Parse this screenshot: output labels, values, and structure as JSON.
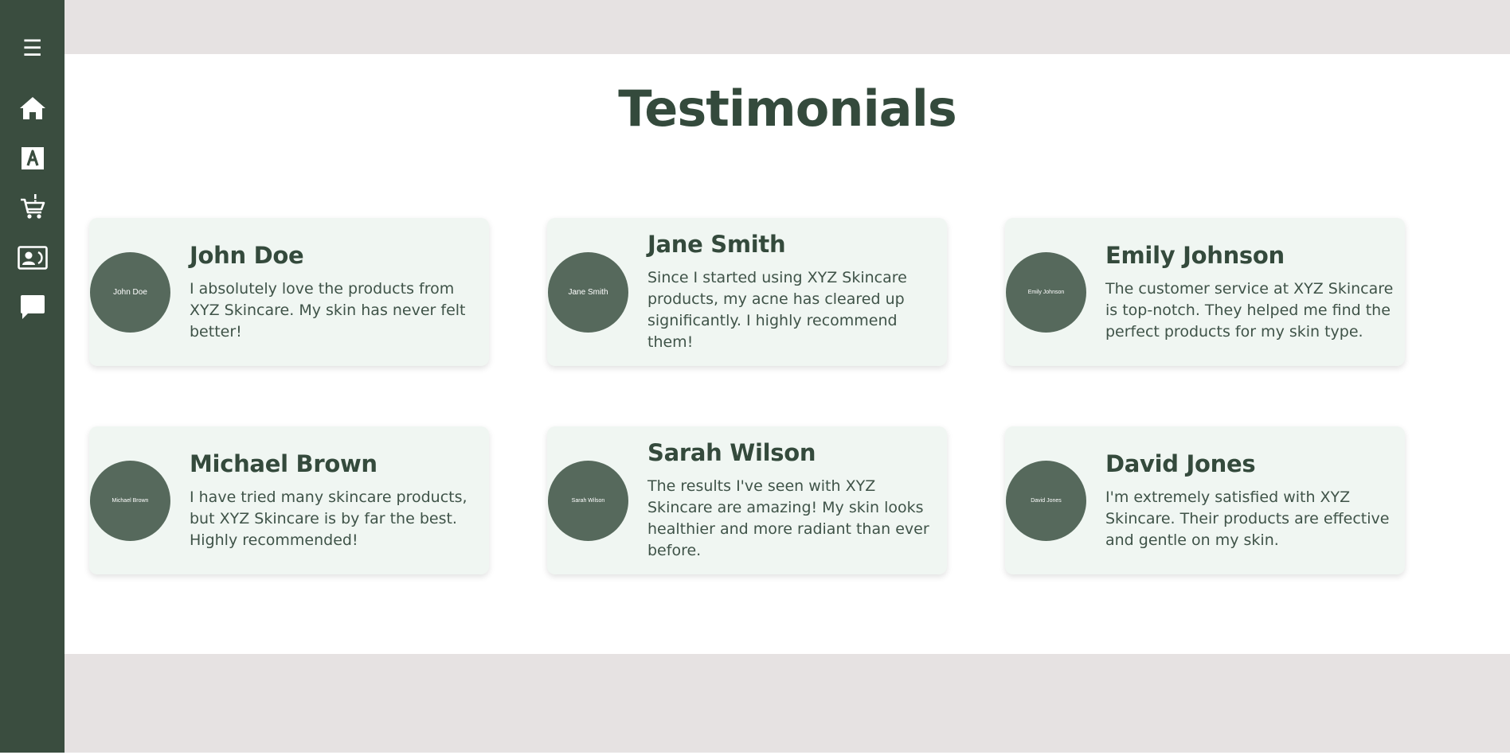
{
  "sidebar": {
    "menu_icon": "☰",
    "items": [
      {
        "name": "home",
        "icon": "home-icon"
      },
      {
        "name": "about",
        "icon": "font-a-icon"
      },
      {
        "name": "shop",
        "icon": "cart-icon"
      },
      {
        "name": "contact",
        "icon": "contact-card-icon"
      },
      {
        "name": "testimonials",
        "icon": "chat-bubble-icon"
      }
    ]
  },
  "page": {
    "title": "Testimonials"
  },
  "testimonials": [
    {
      "name": "John Doe",
      "avatar_text": "John Doe",
      "text": "I absolutely love the products from XYZ Skincare. My skin has never felt better!"
    },
    {
      "name": "Jane Smith",
      "avatar_text": "Jane Smith",
      "text": "Since I started using XYZ Skincare products, my acne has cleared up significantly. I highly recommend them!"
    },
    {
      "name": "Emily Johnson",
      "avatar_text": "Emily Johnson",
      "text": "The customer service at XYZ Skincare is top-notch. They helped me find the perfect products for my skin type."
    },
    {
      "name": "Michael Brown",
      "avatar_text": "Michael Brown",
      "text": "I have tried many skincare products, but XYZ Skincare is by far the best. Highly recommended!"
    },
    {
      "name": "Sarah Wilson",
      "avatar_text": "Sarah Wilson",
      "text": "The results I've seen with XYZ Skincare are amazing! My skin looks healthier and more radiant than ever before."
    },
    {
      "name": "David Jones",
      "avatar_text": "David Jones",
      "text": "I'm extremely satisfied with XYZ Skincare. Their products are effective and gentle on my skin."
    }
  ],
  "colors": {
    "sidebar": "#3a4d3f",
    "band": "#e6e2e2",
    "card": "#f0f6f2",
    "avatar": "#56695c",
    "heading": "#344a3c"
  }
}
